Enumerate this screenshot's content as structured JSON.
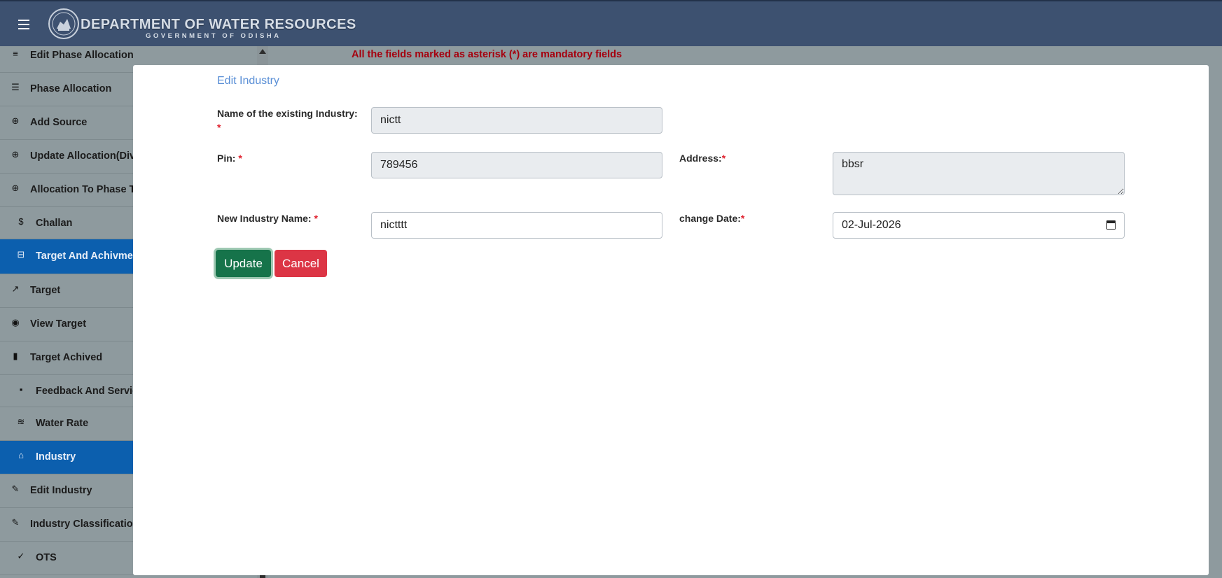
{
  "header": {
    "title": "DEPARTMENT OF WATER RESOURCES",
    "subtitle": "GOVERNMENT OF ODISHA",
    "menu_icon": "hamburger-menu-icon",
    "emblem_icon": "odisha-emblem-icon"
  },
  "sidebar": {
    "items": [
      {
        "label": "Edit Phase Allocation",
        "icon": "edit-list-icon",
        "glyph": "≡"
      },
      {
        "label": "Phase Allocation",
        "icon": "layers-icon",
        "glyph": "☰"
      },
      {
        "label": "Add Source",
        "icon": "add-circle-icon",
        "glyph": "⊕"
      },
      {
        "label": "Update Allocation(Div",
        "icon": "add-circle-icon",
        "glyph": "⊕"
      },
      {
        "label": "Allocation To Phase T",
        "icon": "add-circle-icon",
        "glyph": "⊕"
      },
      {
        "label": "Challan",
        "icon": "dollar-circle-icon",
        "glyph": "$"
      },
      {
        "label": "Target And Achivmen",
        "icon": "toolbox-icon",
        "glyph": "⊟"
      },
      {
        "label": "Target",
        "icon": "trending-up-icon",
        "glyph": "↗"
      },
      {
        "label": "View Target",
        "icon": "eye-icon",
        "glyph": "◉"
      },
      {
        "label": "Target Achived",
        "icon": "bar-chart-icon",
        "glyph": "▮"
      },
      {
        "label": "Feedback And Service",
        "icon": "feedback-icon",
        "glyph": "▪"
      },
      {
        "label": "Water Rate",
        "icon": "waves-icon",
        "glyph": "≋"
      },
      {
        "label": "Industry",
        "icon": "industry-bank-icon",
        "glyph": "⌂"
      },
      {
        "label": "Edit Industry",
        "icon": "pencil-icon",
        "glyph": "✎"
      },
      {
        "label": "Industry Classification",
        "icon": "pencil-icon",
        "glyph": "✎"
      },
      {
        "label": "OTS",
        "icon": "check-icon",
        "glyph": "✓"
      }
    ]
  },
  "page": {
    "mandatory_note": "All the fields marked as asterisk (*) are mandatory fields"
  },
  "modal": {
    "title": "Edit Industry",
    "existing_name_label": "Name of the existing Industry:",
    "existing_name_value": "nictt",
    "pin_label": "Pin:",
    "pin_value": "789456",
    "address_label": "Address:",
    "address_value": "bbsr",
    "new_name_label": "New Industry Name:",
    "new_name_value": "nictttt",
    "change_date_label": "change Date:",
    "change_date_value": "02-Jul-2026",
    "required_mark": "*",
    "update_label": "Update",
    "cancel_label": "Cancel",
    "calendar_icon": "calendar-icon"
  },
  "colors": {
    "header_bg": "#3d5170",
    "active_item_bg": "#0c5fae",
    "update_btn": "#16734a",
    "cancel_btn": "#dc3545",
    "mandatory_text": "#a6000e",
    "modal_title": "#5a8fd6"
  }
}
